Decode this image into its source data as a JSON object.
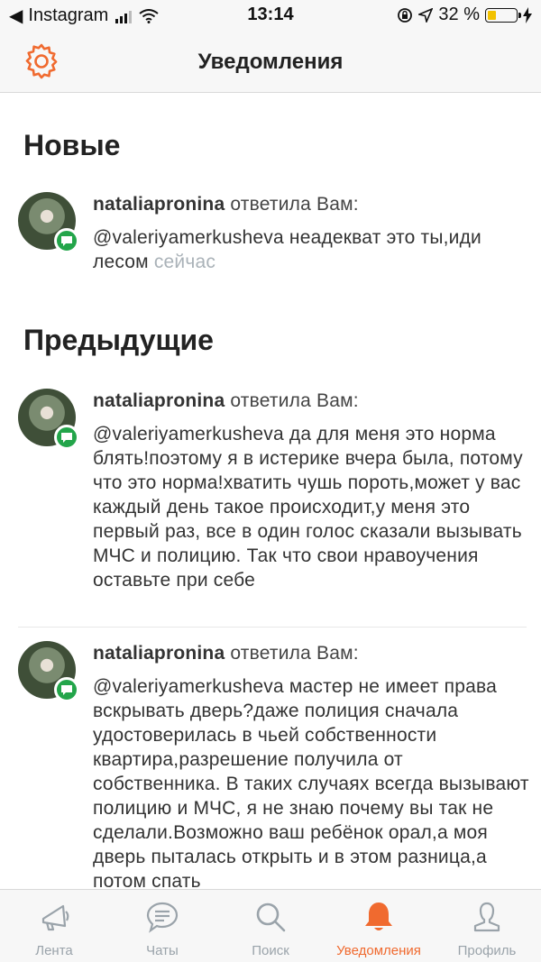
{
  "status_bar": {
    "back_glyph": "◀",
    "app": "Instagram",
    "time": "13:14",
    "battery_percent": "32 %",
    "battery_level": 0.32
  },
  "header": {
    "title": "Уведомления",
    "icon": "gear-icon"
  },
  "sections": {
    "new": {
      "title": "Новые",
      "items": [
        {
          "user": "nataliapronina",
          "action": "ответила Вам:",
          "text": "@valeriyamerkusheva неадекват это ты,иди лесом",
          "time": "сейчас"
        }
      ]
    },
    "previous": {
      "title": "Предыдущие",
      "items": [
        {
          "user": "nataliapronina",
          "action": "ответила Вам:",
          "text": "@valeriyamerkusheva да для меня это норма блять!поэтому я в истерике вчера была, потому что это норма!хватить чушь пороть,может у вас каждый день такое происходит,у меня это первый раз, все в один голос сказали вызывать МЧС и полицию. Так что свои нравоучения оставьте при себе"
        },
        {
          "user": "nataliapronina",
          "action": "ответила Вам:",
          "text": "@valeriyamerkusheva мастер не имеет права вскрывать дверь?даже полиция сначала удостоверилась в чьей собственности квартира,разрешение получила от собственника. В таких случаях всегда вызывают полицию и МЧС, я не знаю почему вы так не сделали.Возможно ваш ребёнок орал,а моя дверь пыталась открыть и в этом разница,а потом спать"
        }
      ]
    }
  },
  "tabs": [
    {
      "label": "Лента",
      "icon": "megaphone-icon"
    },
    {
      "label": "Чаты",
      "icon": "chat-bubble-icon"
    },
    {
      "label": "Поиск",
      "icon": "search-icon"
    },
    {
      "label": "Уведомления",
      "icon": "bell-icon",
      "active": true
    },
    {
      "label": "Профиль",
      "icon": "person-icon"
    }
  ],
  "colors": {
    "accent": "#f06a2f",
    "badge": "#23a54a",
    "muted": "#9aa3aa",
    "battery": "#f2c200"
  }
}
